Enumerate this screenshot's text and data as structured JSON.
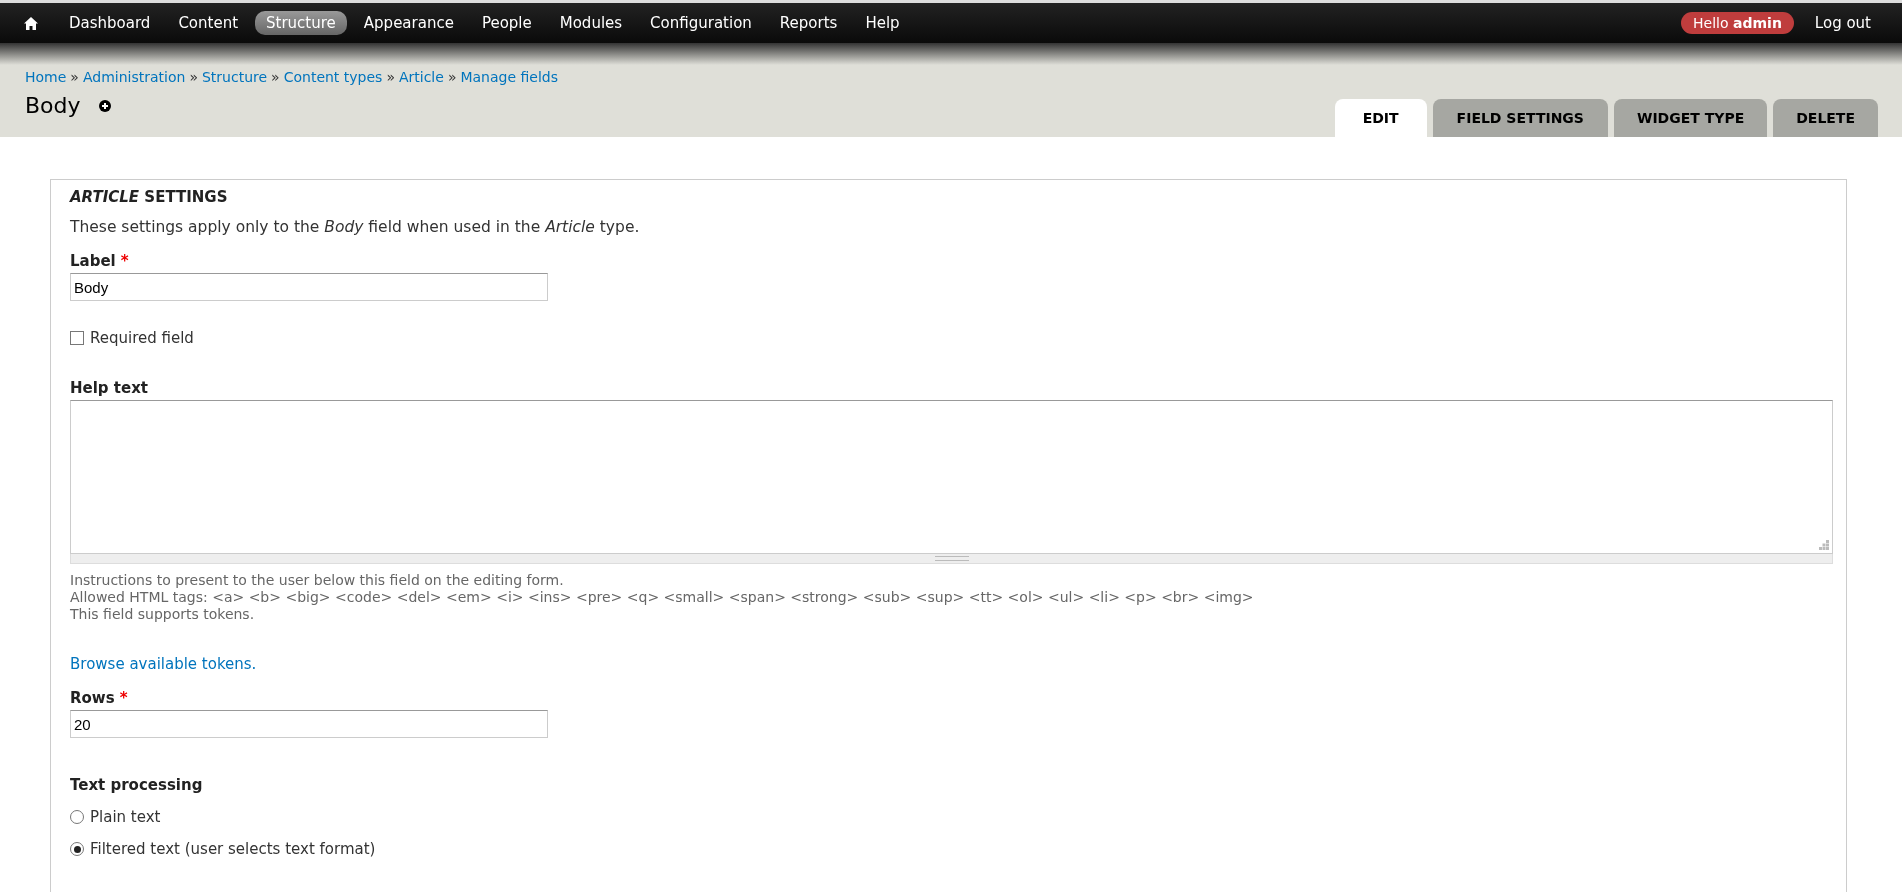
{
  "toolbar": {
    "items": [
      {
        "label": "Dashboard",
        "selected": false
      },
      {
        "label": "Content",
        "selected": false
      },
      {
        "label": "Structure",
        "selected": true
      },
      {
        "label": "Appearance",
        "selected": false
      },
      {
        "label": "People",
        "selected": false
      },
      {
        "label": "Modules",
        "selected": false
      },
      {
        "label": "Configuration",
        "selected": false
      },
      {
        "label": "Reports",
        "selected": false
      },
      {
        "label": "Help",
        "selected": false
      }
    ],
    "greeting": "Hello **admin**",
    "logout": "Log out"
  },
  "breadcrumb": [
    "Home",
    "Administration",
    "Structure",
    "Content types",
    "Article",
    "Manage fields"
  ],
  "breadcrumb_separator": "»",
  "required_marker": "*",
  "page_title": "Body",
  "tabs": [
    {
      "label": "EDIT",
      "selected": true
    },
    {
      "label": "FIELD SETTINGS",
      "selected": false
    },
    {
      "label": "WIDGET TYPE",
      "selected": false
    },
    {
      "label": "DELETE",
      "selected": false
    }
  ],
  "fieldset": {
    "legend": "*ARTICLE* SETTINGS",
    "description": "These settings apply only to the *Body* field when used in the *Article* type.",
    "label_field": {
      "label": "Label",
      "required": true,
      "value": "Body"
    },
    "required_checkbox": {
      "label": "Required field",
      "checked": false
    },
    "help_text": {
      "label": "Help text",
      "descriptions": [
        "Instructions to present to the user below this field on the editing form.",
        "Allowed HTML tags: <a> <b> <big> <code> <del> <em> <i> <ins> <pre> <q> <small> <span> <strong> <sub> <sup> <tt> <ol> <ul> <li> <p> <br> <img>",
        "This field supports tokens."
      ]
    },
    "tokens_link": "Browse available tokens.",
    "rows_field": {
      "label": "Rows",
      "required": true,
      "value": "20"
    },
    "text_processing": {
      "label": "Text processing",
      "options": [
        {
          "label": "Plain text",
          "selected": false
        },
        {
          "label": "Filtered text (user selects text format)",
          "selected": true
        }
      ]
    }
  }
}
